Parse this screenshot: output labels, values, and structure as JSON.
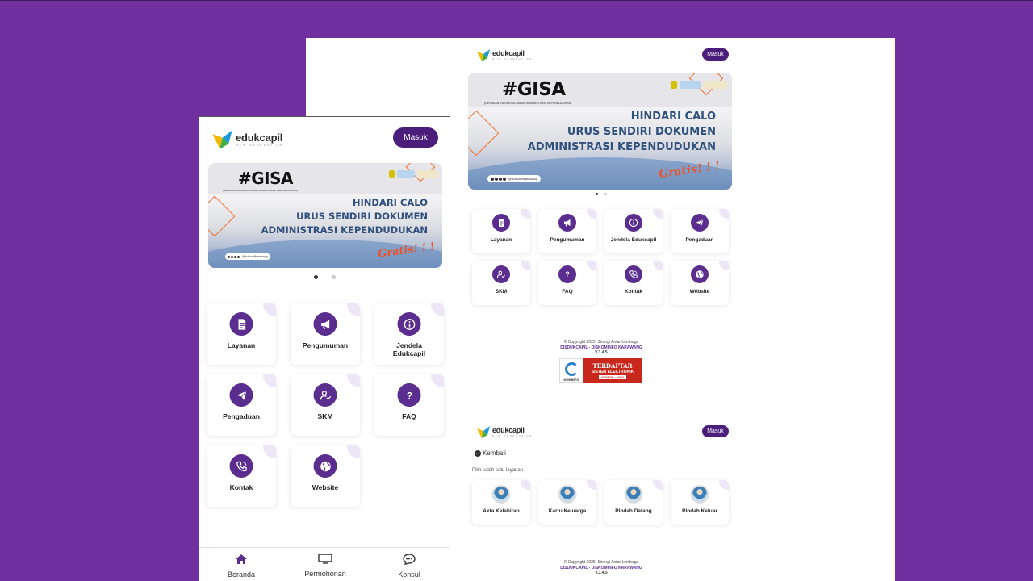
{
  "brand": {
    "name": "edukcapil",
    "tagline": "NEW GENERATION"
  },
  "header": {
    "login_label": "Masuk"
  },
  "banner": {
    "hashtag": "#GISA",
    "subtitle": "(GERAKAN INDONESIA SADAR ADMINISTRASI KEPENDUDUKAN)",
    "lines": [
      "HINDARI CALO",
      "URUS SENDIRI DOKUMEN",
      "ADMINISTRASI KEPENDUDUKAN"
    ],
    "free_label": "Gratis! ! !",
    "social_handle": "@dukcapilkarawang"
  },
  "menu": [
    {
      "label": "Layanan",
      "icon": "document-icon"
    },
    {
      "label": "Pengumuman",
      "icon": "megaphone-icon"
    },
    {
      "label": "Jendela Edukcapil",
      "icon": "info-icon"
    },
    {
      "label": "Pengaduan",
      "icon": "send-icon"
    },
    {
      "label": "SKM",
      "icon": "user-check-icon"
    },
    {
      "label": "FAQ",
      "icon": "question-icon"
    },
    {
      "label": "Kontak",
      "icon": "phone-icon"
    },
    {
      "label": "Website",
      "icon": "globe-icon"
    }
  ],
  "footer": {
    "copyright": "© Copyright 2025. Sinergi Antar Lembaga",
    "org": "DISDUKCAPIL - DISKOMINFO KARAWANG",
    "version": "V.3.4.5",
    "pse_top": "TERDAFTAR",
    "pse_mid": "SISTEM ELEKTRONIK",
    "pse_num": "NOMOR : 1003",
    "kominfo": "KOMINFO"
  },
  "layanan_page": {
    "back_label": "Kembali",
    "prompt": "Pilih salah satu layanan",
    "services": [
      "Akta Kelahiran",
      "Kartu Keluarga",
      "Pindah Datang",
      "Pindah Keluar"
    ]
  },
  "bottom_nav": [
    {
      "label": "Beranda",
      "icon": "home-icon"
    },
    {
      "label": "Permohonan",
      "icon": "monitor-icon"
    },
    {
      "label": "Konsul",
      "icon": "chat-icon"
    }
  ],
  "colors": {
    "background": "#7030a0",
    "primary": "#4a1e7a",
    "icon_circle": "#5b2d8e",
    "banner_blue": "#2f4f7c",
    "accent_orange": "#e8542d"
  }
}
